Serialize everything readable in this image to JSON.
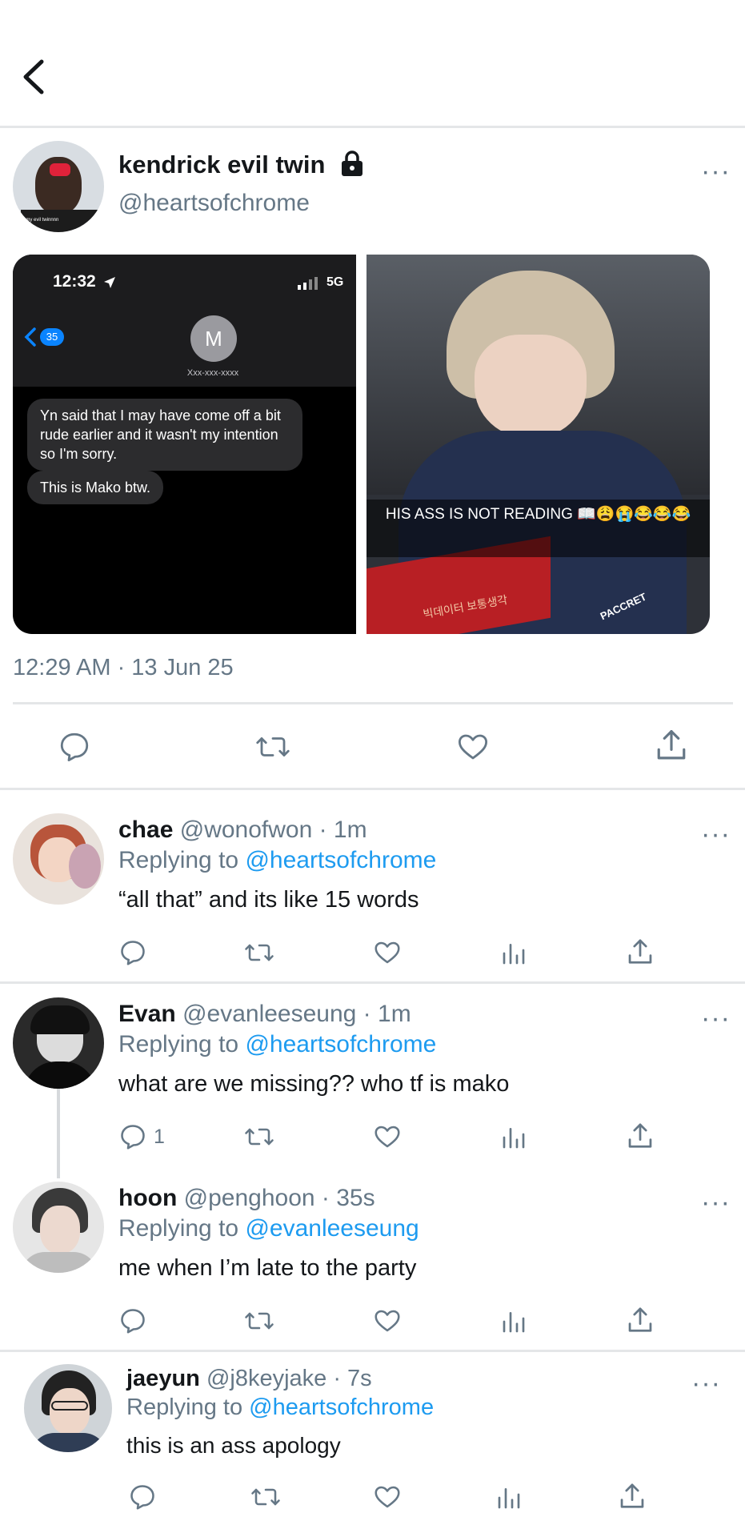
{
  "tweet": {
    "display_name": "kendrick evil twin",
    "handle": "@heartsofchrome",
    "avatar_caption": "why my evil twinnnn",
    "timestamp": "12:29 AM · 13 Jun 25",
    "more": "···"
  },
  "media": {
    "left": {
      "time": "12:32",
      "signal": "5G",
      "back_count": "35",
      "contact_initial": "M",
      "contact_number": "Xxx-xxx-xxxx",
      "bubble1": "Yn said that I may have come off a bit rude earlier and it wasn't my intention so I'm sorry.",
      "bubble2": "This is Mako btw."
    },
    "right": {
      "caption": "HIS ASS IS NOT READING 📖😩😭😂😂😂",
      "jersey_text": "PACCRET",
      "book_text": "빅데이터 보통생각"
    }
  },
  "replies": [
    {
      "name": "chae",
      "handle": "@wonofwon · 1m",
      "replying_label": "Replying to",
      "replying_to": "@heartsofchrome",
      "text": "“all that” and its like 15 words",
      "reply_count": "",
      "more": "···"
    },
    {
      "name": "Evan",
      "handle": "@evanleeseung · 1m",
      "replying_label": "Replying to",
      "replying_to": "@heartsofchrome",
      "text": "what are we missing?? who tf is mako",
      "reply_count": "1",
      "more": "···"
    },
    {
      "name": "hoon",
      "handle": "@penghoon · 35s",
      "replying_label": "Replying to",
      "replying_to": "@evanleeseung",
      "text": "me when I’m late to the party",
      "reply_count": "",
      "more": "···"
    },
    {
      "name": "jaeyun",
      "handle": "@j8keyjake · 7s",
      "replying_label": "Replying to",
      "replying_to": "@heartsofchrome",
      "text": "this is an ass apology",
      "reply_count": "",
      "more": "···"
    }
  ],
  "colors": {
    "accent": "#1d9bf0",
    "muted": "#657786",
    "divider": "#e4e6e8",
    "text": "#14171a"
  }
}
